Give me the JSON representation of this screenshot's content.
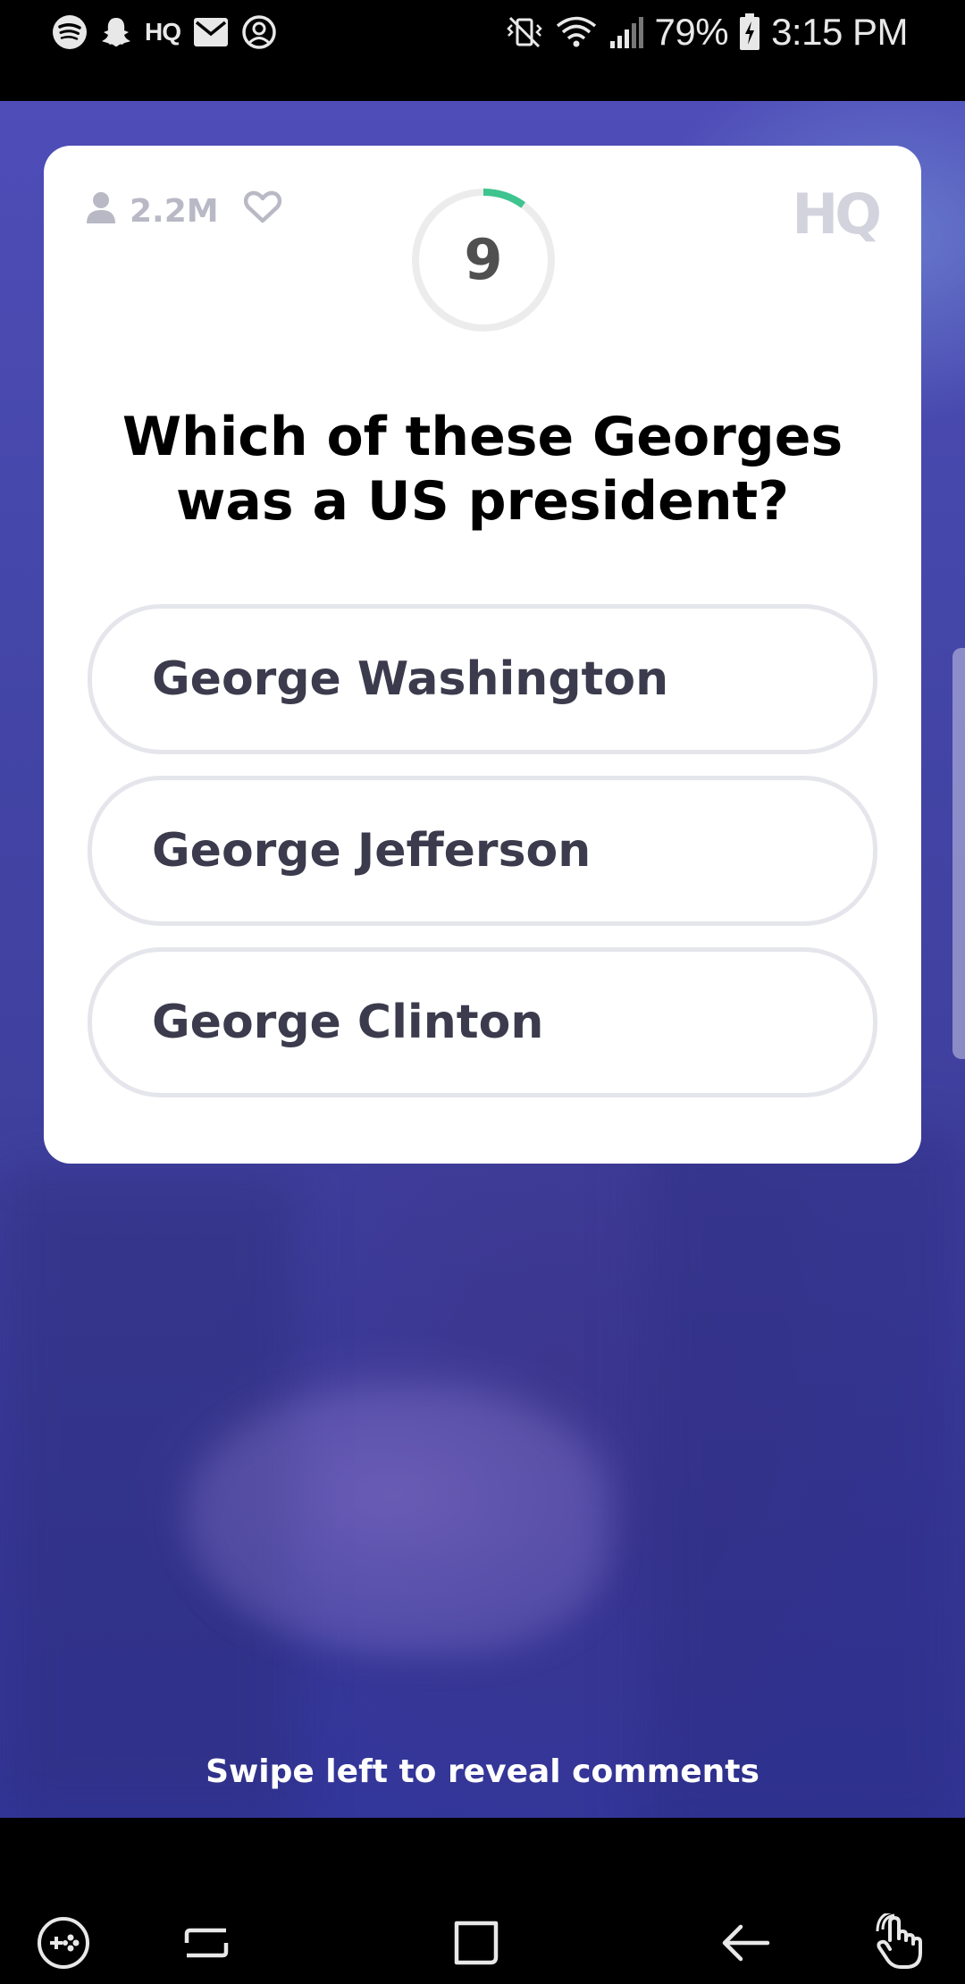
{
  "status_bar": {
    "left_icons": [
      "spotify-icon",
      "snapchat-icon",
      "hq-icon",
      "email-icon",
      "account-icon"
    ],
    "hq_label": "HQ",
    "right_icons": [
      "vibrate-mute-icon",
      "wifi-icon",
      "signal-icon"
    ],
    "battery_percent": "79%",
    "time": "3:15 PM"
  },
  "game": {
    "viewer_count": "2.2M",
    "logo": "HQ",
    "timer": "9",
    "timer_progress": 0.1,
    "question": "Which of these Georges was a US president?",
    "answers": [
      {
        "label": "George Washington"
      },
      {
        "label": "George Jefferson"
      },
      {
        "label": "George Clinton"
      }
    ],
    "swipe_hint": "Swipe left to reveal comments"
  },
  "colors": {
    "background": "#4446a8",
    "timer_accent": "#3ec48e",
    "answer_border": "#e5e5ec",
    "answer_text": "#3b3b4d"
  },
  "nav_bar": {
    "buttons": [
      "game-launcher-icon",
      "recents-icon",
      "home-icon",
      "back-icon",
      "touch-icon"
    ]
  }
}
